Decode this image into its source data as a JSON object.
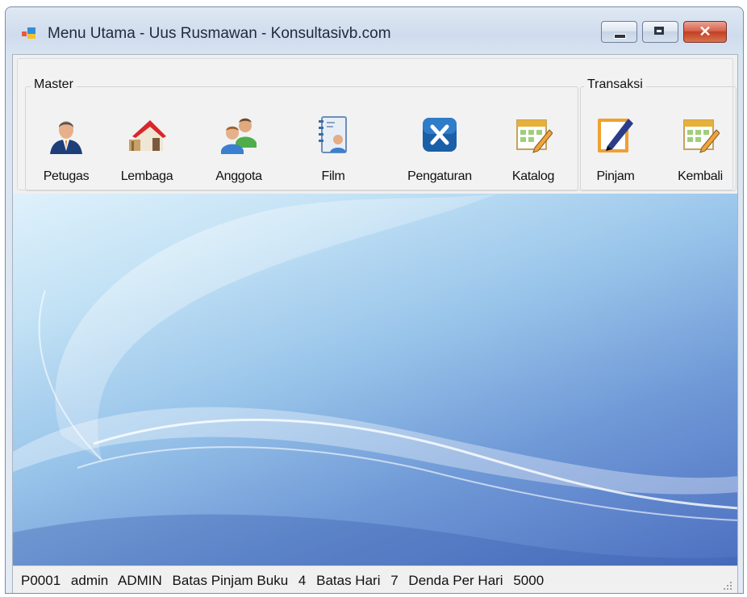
{
  "window": {
    "title": "Menu Utama - Uus Rusmawan - Konsultasivb.com",
    "controls": {
      "minimize": "minimize",
      "maximize": "maximize",
      "close": "close"
    }
  },
  "toolbar": {
    "groups": [
      {
        "caption": "Master",
        "items": [
          {
            "label": "Petugas",
            "icon": "officer-person-icon"
          },
          {
            "label": "Lembaga",
            "icon": "house-icon"
          },
          {
            "label": "Anggota",
            "icon": "members-group-icon"
          },
          {
            "label": "Film",
            "icon": "address-book-icon"
          },
          {
            "label": "Pengaturan",
            "icon": "settings-tools-icon"
          },
          {
            "label": "Katalog",
            "icon": "calendar-pencil-icon"
          }
        ]
      },
      {
        "caption": "Transaksi",
        "items": [
          {
            "label": "Pinjam",
            "icon": "sign-document-pen-icon"
          },
          {
            "label": "Kembali",
            "icon": "calendar-pencil-icon"
          }
        ]
      }
    ]
  },
  "status_bar": {
    "user_id": "P0001",
    "username": "admin",
    "role": "ADMIN",
    "borrow_limit_label": "Batas Pinjam Buku",
    "borrow_limit_value": "4",
    "day_limit_label": "Batas Hari",
    "day_limit_value": "7",
    "fine_label": "Denda Per Hari",
    "fine_value": "5000"
  },
  "colors": {
    "close_button": "#c13f25",
    "background_blue": "#6e98d6",
    "settings_icon": "#1b5fa8"
  }
}
